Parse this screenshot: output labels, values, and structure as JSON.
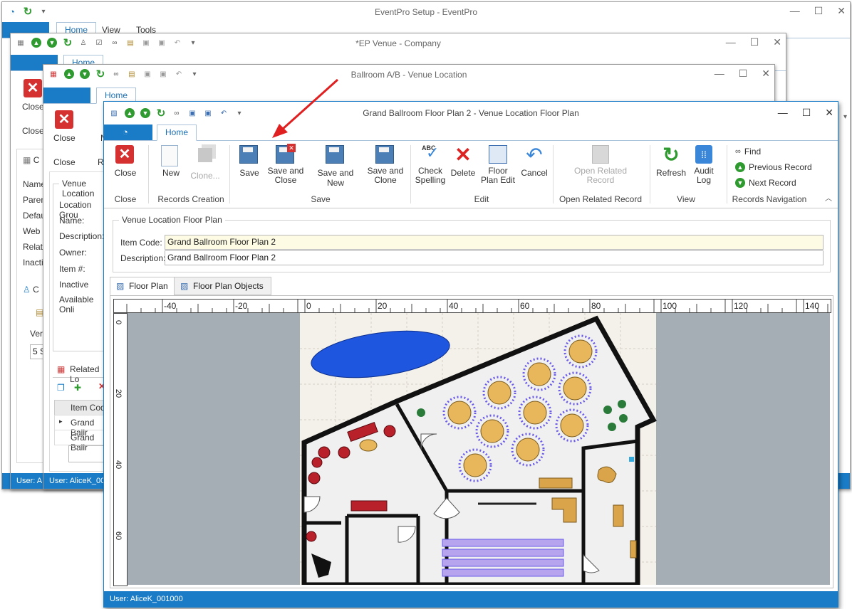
{
  "windows": {
    "main": {
      "title": "EventPro Setup - EventPro",
      "tabs": [
        "Home",
        "View",
        "Tools"
      ]
    },
    "company": {
      "title": "*EP Venue - Company",
      "home_tab": "Home",
      "close_label": "Close",
      "close_label2": "Close",
      "side_labels": [
        "Name",
        "Paren",
        "Defau",
        "Web S",
        "Relati",
        "Inacti"
      ],
      "tab_c": "C",
      "vehicle": "Ver",
      "value_5": "5 S",
      "status": "User: A"
    },
    "location": {
      "title": "Ballroom A/B - Venue Location",
      "home_tab": "Home",
      "close_label": "Close",
      "close_group": "Close",
      "n_label": "N",
      "re_label": "Re",
      "section_title": "Venue Location",
      "fields": [
        "Location Grou",
        "Name:",
        "Description:",
        "Owner:",
        "Item #:",
        "Inactive",
        "Available Onli"
      ],
      "related_title": "Related Lo",
      "grid_header": "Item Code",
      "grid_rows": [
        "Grand Ballr",
        "Grand Ballr"
      ],
      "status": "User: AliceK_001"
    }
  },
  "floor_window": {
    "title": "Grand Ballroom Floor Plan 2 - Venue Location Floor Plan",
    "home_tab": "Home",
    "ribbon": {
      "close": "Close",
      "new": "New",
      "clone": "Clone...",
      "save": "Save",
      "save_close": [
        "Save and",
        "Close"
      ],
      "save_new": "Save and New",
      "save_clone": [
        "Save and",
        "Clone"
      ],
      "check_spelling": [
        "Check",
        "Spelling"
      ],
      "abc": "ABC",
      "delete": "Delete",
      "floor_plan_edit": [
        "Floor",
        "Plan Edit"
      ],
      "cancel": "Cancel",
      "open_related": [
        "Open Related",
        "Record"
      ],
      "refresh": "Refresh",
      "audit_log": [
        "Audit",
        "Log"
      ],
      "find": "Find",
      "previous_record": "Previous Record",
      "next_record": "Next Record"
    },
    "groups": {
      "close": "Close",
      "records_creation": "Records Creation",
      "save": "Save",
      "edit": "Edit",
      "open_related": "Open Related Record",
      "view": "View",
      "records_navigation": "Records Navigation"
    },
    "section_title": "Venue Location Floor Plan",
    "item_code_label": "Item Code:",
    "item_code_value": "Grand Ballroom Floor Plan 2",
    "description_label": "Description:",
    "description_value": "Grand Ballroom Floor Plan 2",
    "tabs": [
      "Floor Plan",
      "Floor Plan Objects"
    ],
    "ruler_x": [
      "-40",
      "-20",
      "0",
      "20",
      "40",
      "60",
      "80",
      "100",
      "120",
      "140"
    ],
    "ruler_y": [
      "0",
      "20",
      "40",
      "60"
    ],
    "status": "User: AliceK_001000"
  },
  "colors": {
    "accent": "#1a7cc7",
    "item_code_bg": "#fdfbe3",
    "canvas_grey": "#a5adb5",
    "arrow": "#e02020"
  }
}
